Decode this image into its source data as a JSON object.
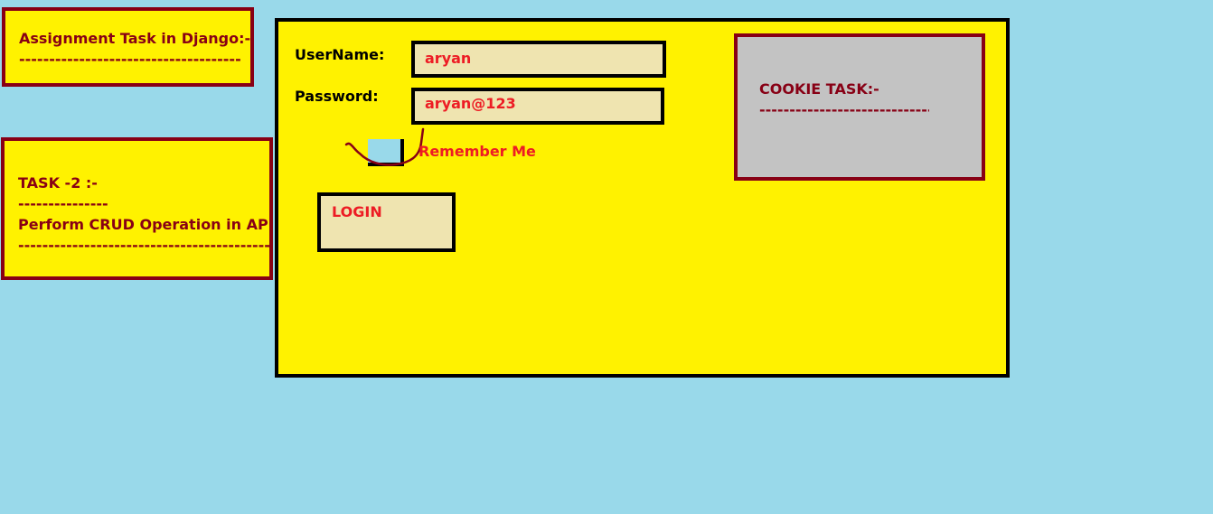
{
  "assignment_note": {
    "title": "Assignment Task in Django:-",
    "divider": "---------------------------------------"
  },
  "task2_note": {
    "title": "TASK -2 :-",
    "title_divider": "---------------",
    "description": "Perform CRUD Operation in API:-",
    "description_divider": "---------------------------------------------"
  },
  "login_form": {
    "username_label": "UserName:",
    "username_value": "aryan",
    "password_label": "Password:",
    "password_value": "aryan@123",
    "remember_label": "Remember Me",
    "remember_checked": false,
    "login_button": "LOGIN"
  },
  "cookie_note": {
    "title": "COOKIE TASK:-",
    "divider": "------------------------------"
  },
  "colors": {
    "background": "#99d9ea",
    "panel": "#fff200",
    "note_border": "#880015",
    "field_fill": "#efe4b0",
    "value_text": "#ed1c24",
    "cookie_fill": "#c3c3c3"
  }
}
